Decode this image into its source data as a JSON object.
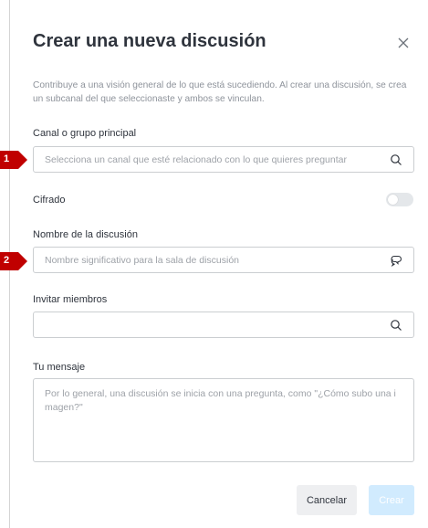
{
  "dialog": {
    "title": "Crear una nueva discusión",
    "description": "Contribuye a una visión general de lo que está sucediendo. Al crear una discusión, se crea un subcanal del que seleccionaste y ambos se vinculan."
  },
  "parent_channel": {
    "label": "Canal o grupo principal",
    "placeholder": "Selecciona un canal que esté relacionado con lo que quieres preguntar",
    "value": ""
  },
  "encrypted": {
    "label": "Cifrado",
    "enabled": false
  },
  "discussion_name": {
    "label": "Nombre de la discusión",
    "placeholder": "Nombre significativo para la sala de discusión",
    "value": ""
  },
  "invite_members": {
    "label": "Invitar miembros",
    "placeholder": "",
    "value": ""
  },
  "message": {
    "label": "Tu mensaje",
    "placeholder": "Por lo general, una discusión se inicia con una pregunta, como \"¿Cómo subo una i magen?\"",
    "value": ""
  },
  "buttons": {
    "cancel": "Cancelar",
    "create": "Crear"
  },
  "markers": [
    "1",
    "2"
  ],
  "colors": {
    "marker": "#c00000",
    "create_button_disabled": "#d1ebfe",
    "title_text": "#2f343d"
  }
}
